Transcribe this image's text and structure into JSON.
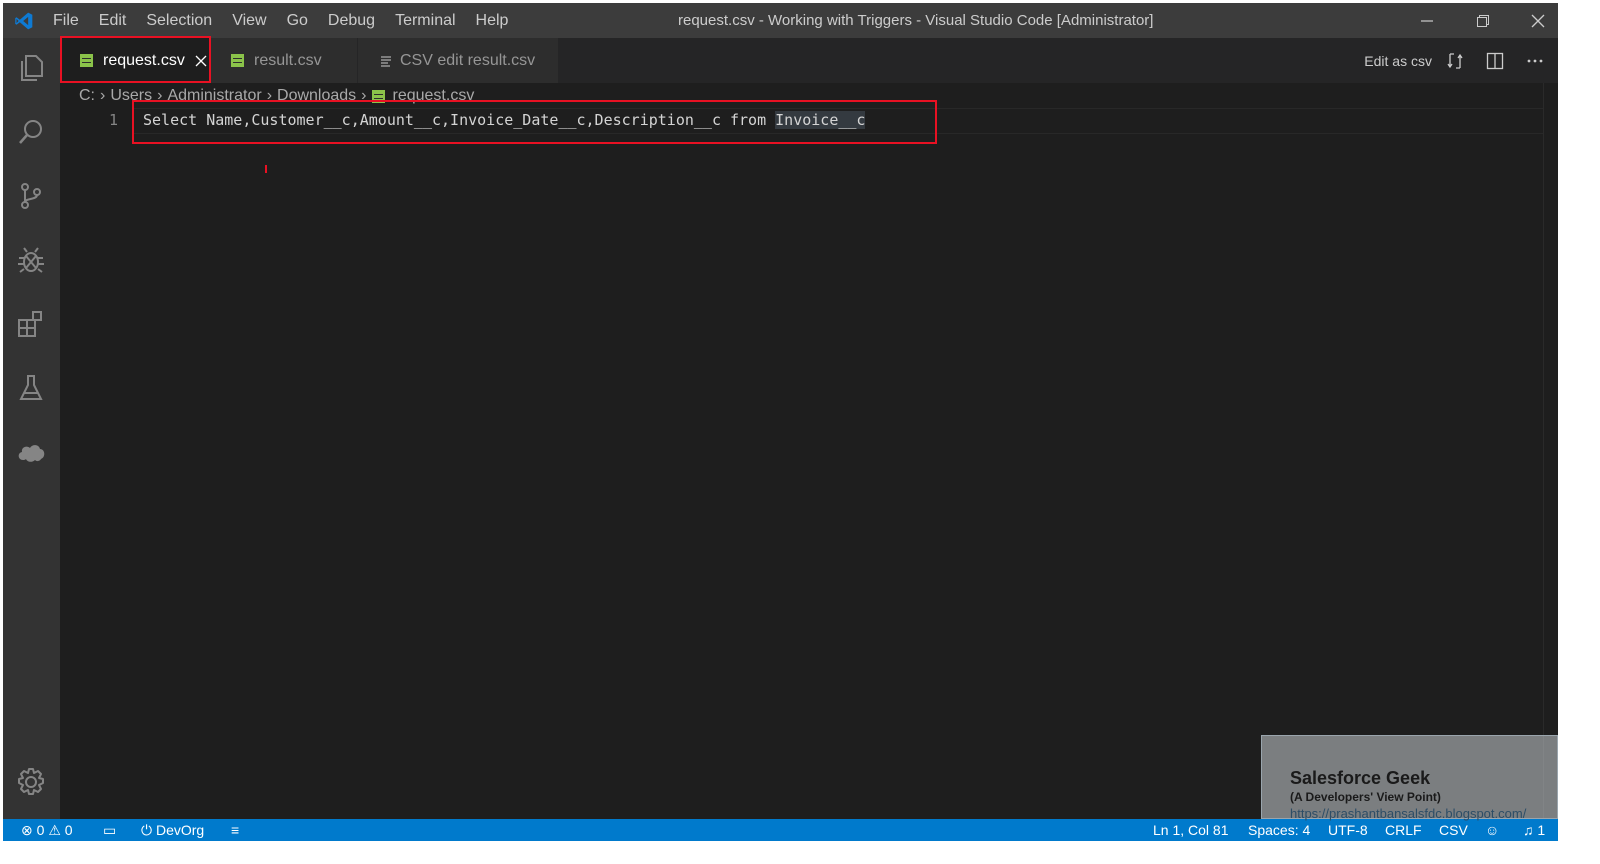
{
  "titlebar": {
    "menu": [
      "File",
      "Edit",
      "Selection",
      "View",
      "Go",
      "Debug",
      "Terminal",
      "Help"
    ],
    "window_title": "request.csv - Working with Triggers - Visual Studio Code [Administrator]"
  },
  "activity_bar": {
    "icons": [
      "explorer-icon",
      "search-icon",
      "source-control-icon",
      "debug-icon",
      "extensions-icon",
      "test-flask-icon",
      "salesforce-cloud-icon",
      "settings-gear-icon"
    ]
  },
  "tabs": [
    {
      "label": "request.csv",
      "active": true,
      "icon": "csv-file-icon"
    },
    {
      "label": "result.csv",
      "active": false,
      "icon": "csv-file-icon"
    },
    {
      "label": "CSV edit result.csv",
      "active": false,
      "icon": "list-icon"
    }
  ],
  "editor_actions": {
    "edit_as_csv": "Edit as csv"
  },
  "breadcrumb": [
    "C:",
    "Users",
    "Administrator",
    "Downloads",
    "request.csv"
  ],
  "editor": {
    "line_number": "1",
    "code_prefix": "Select Name,Customer__c,Amount__c,Invoice_Date__c,Description__c from ",
    "code_highlight": "Invoice__c"
  },
  "statusbar": {
    "problems": "0",
    "warnings": "0",
    "org": "DevOrg",
    "position": "Ln 1, Col 81",
    "spaces": "Spaces: 4",
    "encoding": "UTF-8",
    "eol": "CRLF",
    "language": "CSV",
    "notifications": "1"
  },
  "watermark": {
    "title": "Salesforce Geek",
    "subtitle": "(A Developers' View Point)",
    "url": "https://prashantbansalsfdc.blogspot.com/"
  },
  "colors": {
    "accent_red": "#e81123",
    "statusbar": "#007acc",
    "csv_icon": "#8bc34a"
  }
}
